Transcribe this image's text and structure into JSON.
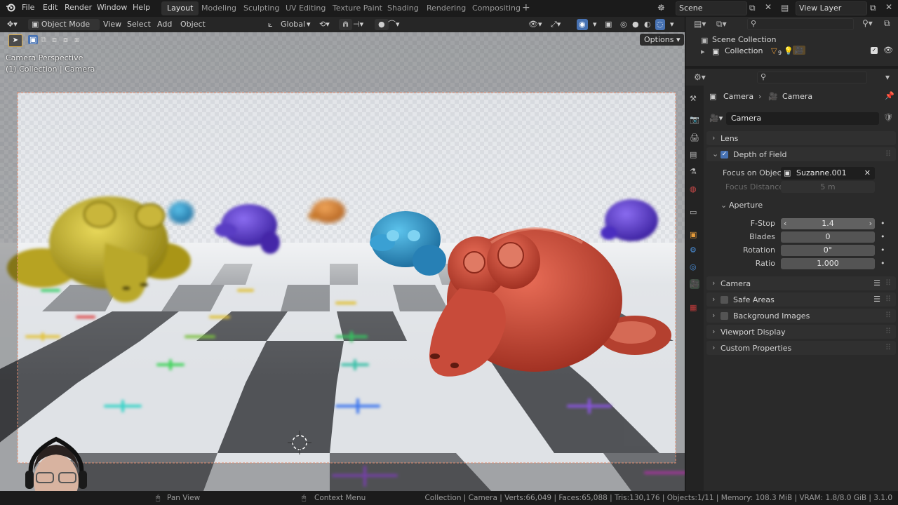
{
  "menubar": {
    "menus": [
      "File",
      "Edit",
      "Render",
      "Window",
      "Help"
    ],
    "workspaces": [
      "Layout",
      "Modeling",
      "Sculpting",
      "UV Editing",
      "Texture Paint",
      "Shading",
      "Rendering",
      "Compositing"
    ],
    "active_workspace": "Layout",
    "add_tab": "+",
    "scene": "Scene",
    "view_layer": "View Layer"
  },
  "viewport_header": {
    "mode": "Object Mode",
    "menus": [
      "View",
      "Select",
      "Add",
      "Object"
    ],
    "transform_orientation": "Global",
    "options": "Options"
  },
  "viewport": {
    "overlay_line1": "Camera Perspective",
    "overlay_line2": "(1) Collection | Camera"
  },
  "outliner": {
    "scene_collection": "Scene Collection",
    "collection": "Collection",
    "badge": "9"
  },
  "properties": {
    "breadcrumb_object": "Camera",
    "breadcrumb_data": "Camera",
    "datablock_name": "Camera",
    "panels": {
      "lens": "Lens",
      "depth_of_field": "Depth of Field",
      "focus_on_object_label": "Focus on Object",
      "focus_on_object_value": "Suzanne.001",
      "focus_distance_label": "Focus Distance",
      "focus_distance_value": "5 m",
      "aperture": "Aperture",
      "fstop_label": "F-Stop",
      "fstop_value": "1.4",
      "blades_label": "Blades",
      "blades_value": "0",
      "rotation_label": "Rotation",
      "rotation_value": "0°",
      "ratio_label": "Ratio",
      "ratio_value": "1.000",
      "camera": "Camera",
      "safe_areas": "Safe Areas",
      "background_images": "Background Images",
      "viewport_display": "Viewport Display",
      "custom_properties": "Custom Properties"
    }
  },
  "statusbar": {
    "pan_view": "Pan View",
    "context_menu": "Context Menu",
    "stats": "Collection | Camera | Verts:66,049 | Faces:65,088 | Tris:130,176 | Objects:1/11 | Memory: 108.3 MiB | VRAM: 1.8/8.0 GiB | 3.1.0"
  },
  "colors": {
    "accent_blue": "#4772b3",
    "suzanne_yellow": "#b7a323",
    "suzanne_red": "#c84b3a",
    "suzanne_blue": "#2f8ec6",
    "suzanne_purple": "#5a3cc4"
  }
}
